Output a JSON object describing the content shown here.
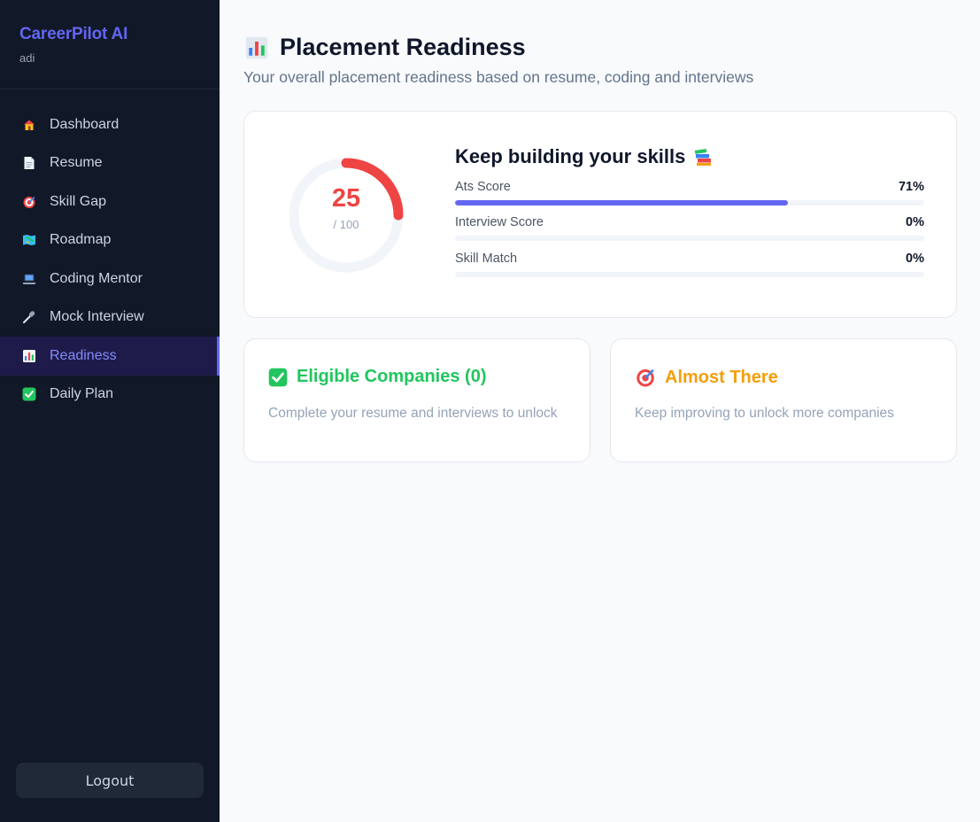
{
  "sidebar": {
    "brand": "CareerPilot AI",
    "user": "adi",
    "items": [
      {
        "label": "Dashboard",
        "icon": "house-icon"
      },
      {
        "label": "Resume",
        "icon": "document-icon"
      },
      {
        "label": "Skill Gap",
        "icon": "target-icon"
      },
      {
        "label": "Roadmap",
        "icon": "map-icon"
      },
      {
        "label": "Coding Mentor",
        "icon": "laptop-icon"
      },
      {
        "label": "Mock Interview",
        "icon": "microphone-icon"
      },
      {
        "label": "Readiness",
        "icon": "chart-icon",
        "active": true
      },
      {
        "label": "Daily Plan",
        "icon": "checkmark-icon"
      }
    ],
    "logout_label": "Logout"
  },
  "header": {
    "title": "Placement Readiness",
    "subtitle": "Your overall placement readiness based on resume, coding and interviews"
  },
  "readiness": {
    "score": "25",
    "max": "/ 100",
    "score_fraction": 0.25,
    "heading": "Keep building your skills",
    "metrics": [
      {
        "label": "Ats Score",
        "value": "71%",
        "fraction": 0.71
      },
      {
        "label": "Interview Score",
        "value": "0%",
        "fraction": 0
      },
      {
        "label": "Skill Match",
        "value": "0%",
        "fraction": 0
      }
    ]
  },
  "eligible": {
    "title": "Eligible Companies (0)",
    "text": "Complete your resume and interviews to unlock"
  },
  "almost": {
    "title": "Almost There",
    "text": "Keep improving to unlock more companies"
  },
  "colors": {
    "accent": "#6366f1",
    "score": "#ef4444",
    "eligible": "#22c55e",
    "almost": "#f59e0b",
    "sidebar_bg": "#111827"
  }
}
